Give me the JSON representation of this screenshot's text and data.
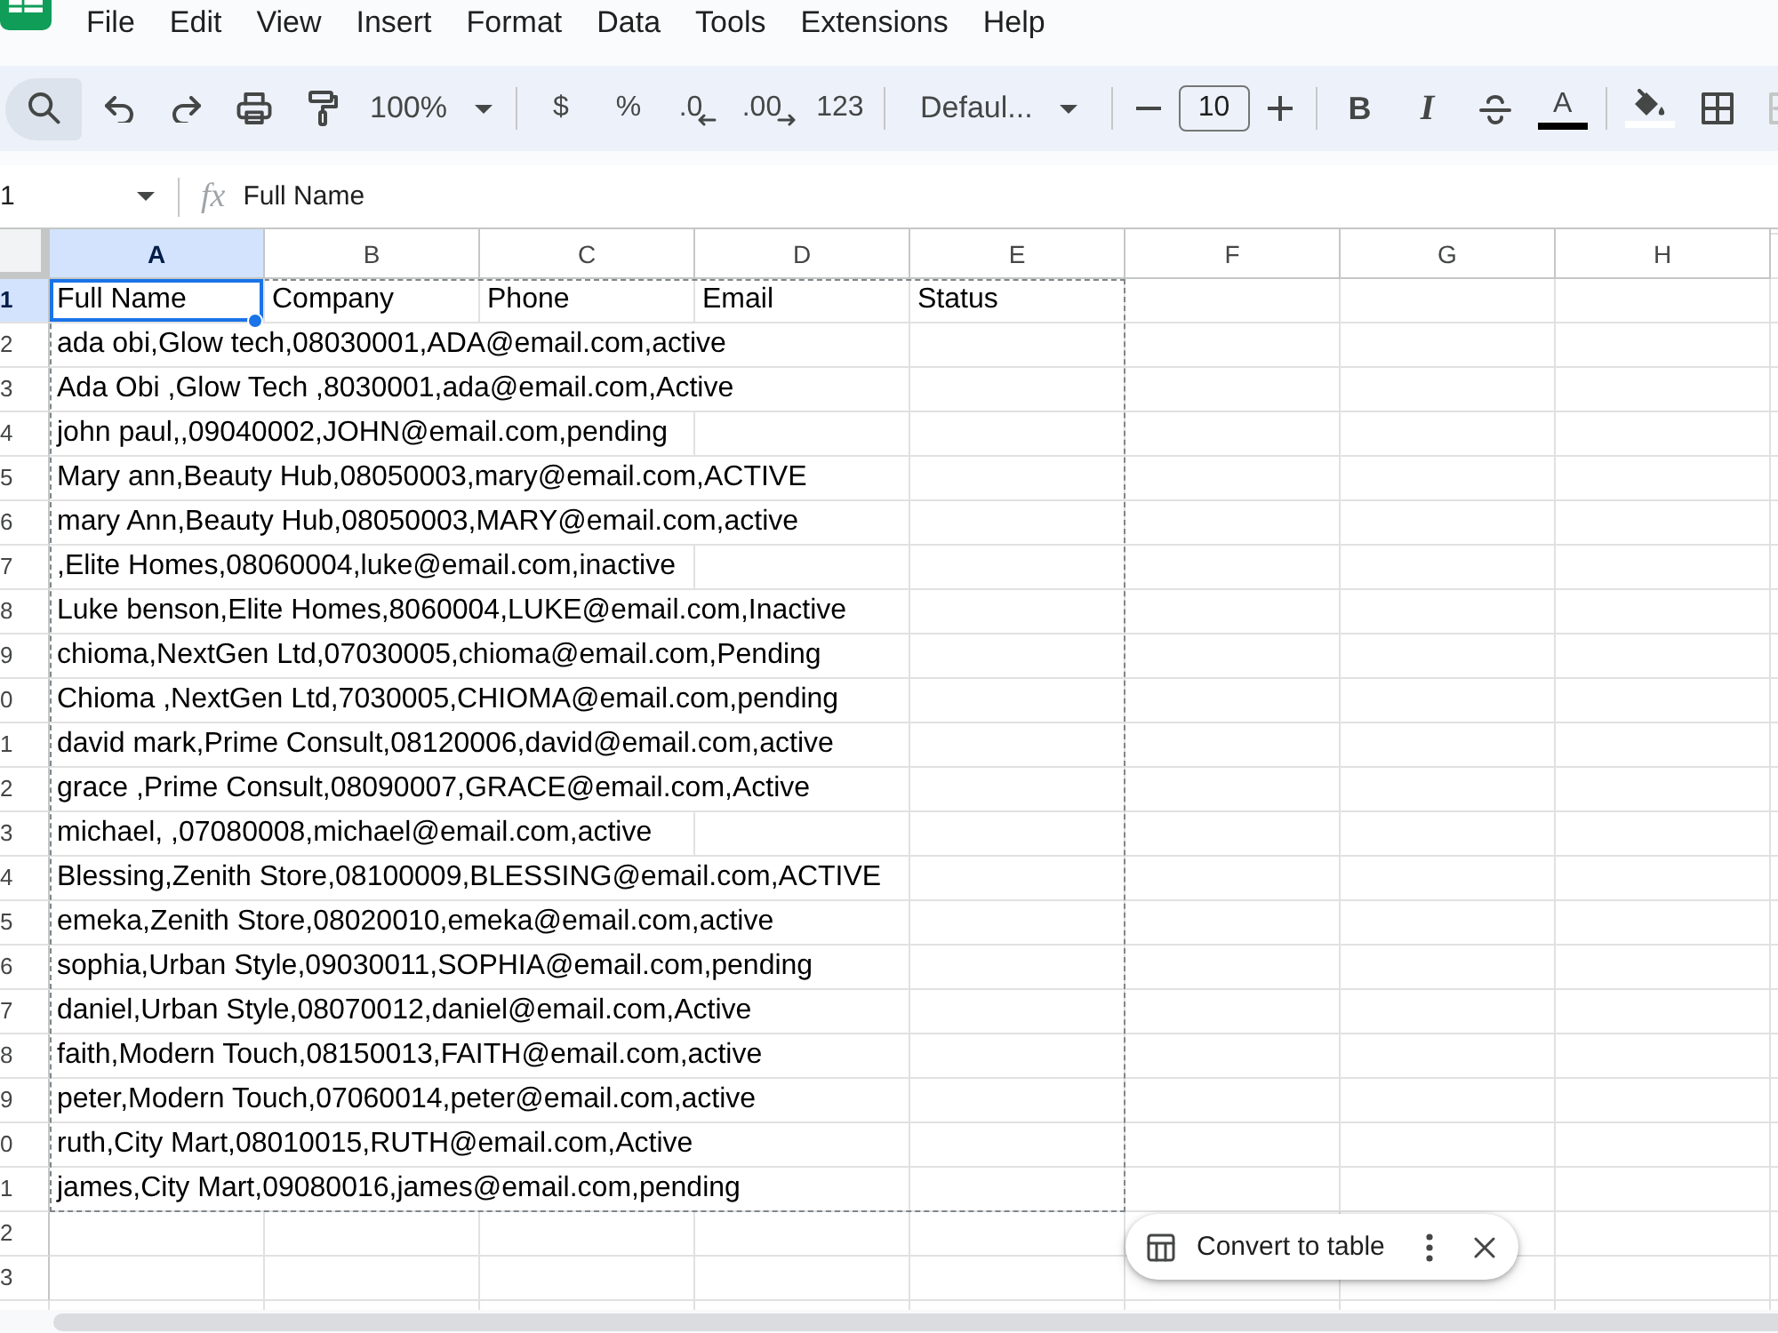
{
  "menu": [
    "File",
    "Edit",
    "View",
    "Insert",
    "Format",
    "Data",
    "Tools",
    "Extensions",
    "Help"
  ],
  "toolbar": {
    "search": {
      "active": true
    },
    "items": [
      {
        "kind": "undo"
      },
      {
        "kind": "redo"
      },
      {
        "kind": "print"
      },
      {
        "kind": "paint-format"
      },
      {
        "kind": "zoom",
        "label": "100%"
      },
      {
        "kind": "separator"
      },
      {
        "kind": "currency",
        "label": "$"
      },
      {
        "kind": "percent",
        "label": "%"
      },
      {
        "kind": "decrease-decimal",
        "label": ".0"
      },
      {
        "kind": "increase-decimal",
        "label": ".00"
      },
      {
        "kind": "number-format",
        "label": "123"
      },
      {
        "kind": "separator"
      },
      {
        "kind": "font",
        "label": "Defaul..."
      },
      {
        "kind": "separator"
      },
      {
        "kind": "font-size-down"
      },
      {
        "kind": "font-size",
        "value": "10"
      },
      {
        "kind": "font-size-up"
      },
      {
        "kind": "separator"
      },
      {
        "kind": "bold",
        "label": "B"
      },
      {
        "kind": "italic",
        "label": "I"
      },
      {
        "kind": "strikethrough"
      },
      {
        "kind": "text-color",
        "label": "A",
        "color": "#000000"
      },
      {
        "kind": "separator"
      },
      {
        "kind": "fill-color",
        "color": "#ffffff"
      },
      {
        "kind": "borders"
      },
      {
        "kind": "merge",
        "disabled": true
      }
    ]
  },
  "formula_bar": {
    "cell_reference": "1",
    "function_symbol": "fx",
    "content": "Full Name"
  },
  "sheet": {
    "copy_marquee": true,
    "columns": [
      {
        "label": "A",
        "selected": true
      },
      {
        "label": "B",
        "selected": false
      },
      {
        "label": "C",
        "selected": false
      },
      {
        "label": "D",
        "selected": false
      },
      {
        "label": "E",
        "selected": false
      },
      {
        "label": "F",
        "selected": false
      },
      {
        "label": "G",
        "selected": false
      },
      {
        "label": "H",
        "selected": false
      }
    ],
    "rows": [
      {
        "number": "1",
        "selected": true,
        "cells": [
          {
            "text": "Full Name",
            "active": true
          },
          {
            "text": "Company",
            "active": false
          },
          {
            "text": "Phone",
            "active": false
          },
          {
            "text": "Email",
            "active": false
          },
          {
            "text": "Status",
            "active": false
          }
        ]
      },
      {
        "number": "2",
        "selected": false,
        "cells": [
          {
            "text": "ada obi,Glow tech,08030001,ADA@email.com,active",
            "active": false
          }
        ]
      },
      {
        "number": "3",
        "selected": false,
        "cells": [
          {
            "text": "Ada Obi ,Glow Tech ,8030001,ada@email.com,Active",
            "active": false
          }
        ]
      },
      {
        "number": "4",
        "selected": false,
        "cells": [
          {
            "text": "john paul,,09040002,JOHN@email.com,pending",
            "active": false
          }
        ]
      },
      {
        "number": "5",
        "selected": false,
        "cells": [
          {
            "text": "Mary ann,Beauty Hub,08050003,mary@email.com,ACTIVE",
            "active": false
          }
        ]
      },
      {
        "number": "6",
        "selected": false,
        "cells": [
          {
            "text": "mary Ann,Beauty Hub,08050003,MARY@email.com,active",
            "active": false
          }
        ]
      },
      {
        "number": "7",
        "selected": false,
        "cells": [
          {
            "text": ",Elite Homes,08060004,luke@email.com,inactive",
            "active": false
          }
        ]
      },
      {
        "number": "8",
        "selected": false,
        "cells": [
          {
            "text": "Luke benson,Elite Homes,8060004,LUKE@email.com,Inactive",
            "active": false
          }
        ]
      },
      {
        "number": "9",
        "selected": false,
        "cells": [
          {
            "text": "chioma,NextGen Ltd,07030005,chioma@email.com,Pending",
            "active": false
          }
        ]
      },
      {
        "number": "0",
        "selected": false,
        "cells": [
          {
            "text": "Chioma ,NextGen Ltd,7030005,CHIOMA@email.com,pending",
            "active": false
          }
        ]
      },
      {
        "number": "1",
        "selected": false,
        "cells": [
          {
            "text": "david mark,Prime Consult,08120006,david@email.com,active",
            "active": false
          }
        ]
      },
      {
        "number": "2",
        "selected": false,
        "cells": [
          {
            "text": "grace ,Prime Consult,08090007,GRACE@email.com,Active",
            "active": false
          }
        ]
      },
      {
        "number": "3",
        "selected": false,
        "cells": [
          {
            "text": "michael, ,07080008,michael@email.com,active",
            "active": false
          }
        ]
      },
      {
        "number": "4",
        "selected": false,
        "cells": [
          {
            "text": "Blessing,Zenith Store,08100009,BLESSING@email.com,ACTIVE",
            "active": false
          }
        ]
      },
      {
        "number": "5",
        "selected": false,
        "cells": [
          {
            "text": "emeka,Zenith Store,08020010,emeka@email.com,active",
            "active": false
          }
        ]
      },
      {
        "number": "6",
        "selected": false,
        "cells": [
          {
            "text": "sophia,Urban Style,09030011,SOPHIA@email.com,pending",
            "active": false
          }
        ]
      },
      {
        "number": "7",
        "selected": false,
        "cells": [
          {
            "text": "daniel,Urban Style,08070012,daniel@email.com,Active",
            "active": false
          }
        ]
      },
      {
        "number": "8",
        "selected": false,
        "cells": [
          {
            "text": "faith,Modern Touch,08150013,FAITH@email.com,active",
            "active": false
          }
        ]
      },
      {
        "number": "9",
        "selected": false,
        "cells": [
          {
            "text": "peter,Modern Touch,07060014,peter@email.com,active",
            "active": false
          }
        ]
      },
      {
        "number": "0",
        "selected": false,
        "cells": [
          {
            "text": "ruth,City Mart,08010015,RUTH@email.com,Active",
            "active": false
          }
        ]
      },
      {
        "number": "1",
        "selected": false,
        "cells": [
          {
            "text": "james,City Mart,09080016,james@email.com,pending",
            "active": false
          }
        ]
      },
      {
        "number": "2",
        "selected": false
      },
      {
        "number": "3",
        "selected": false
      }
    ]
  },
  "toast": {
    "label": "Convert to table"
  }
}
